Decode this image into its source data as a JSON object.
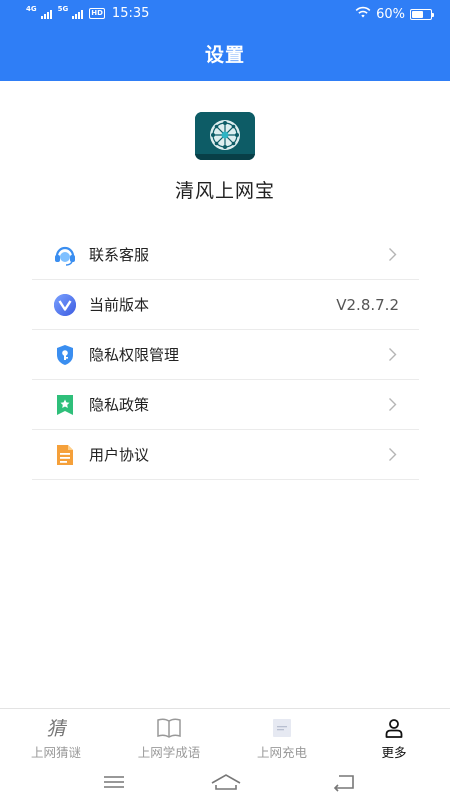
{
  "status": {
    "net1": "4G",
    "net2": "5G",
    "hd": "HD",
    "time": "15:35",
    "battery_text": "60%",
    "battery_level": 0.6
  },
  "header": {
    "title": "设置"
  },
  "app": {
    "name": "清风上网宝"
  },
  "settings": [
    {
      "label": "联系客服",
      "icon": "customer-service-icon",
      "value": ""
    },
    {
      "label": "当前版本",
      "icon": "version-icon",
      "value": "V2.8.7.2"
    },
    {
      "label": "隐私权限管理",
      "icon": "privacy-permission-icon",
      "value": ""
    },
    {
      "label": "隐私政策",
      "icon": "privacy-policy-icon",
      "value": ""
    },
    {
      "label": "用户协议",
      "icon": "user-agreement-icon",
      "value": ""
    }
  ],
  "tabs": [
    {
      "label": "上网猜谜",
      "icon": "riddle-icon",
      "active": false
    },
    {
      "label": "上网学成语",
      "icon": "book-icon",
      "active": false
    },
    {
      "label": "上网充电",
      "icon": "charge-icon",
      "active": false
    },
    {
      "label": "更多",
      "icon": "profile-icon",
      "active": true
    }
  ],
  "colors": {
    "header_bg": "#2f7ef6",
    "active_tab": "#111111",
    "inactive_tab": "#9a9a9a"
  }
}
